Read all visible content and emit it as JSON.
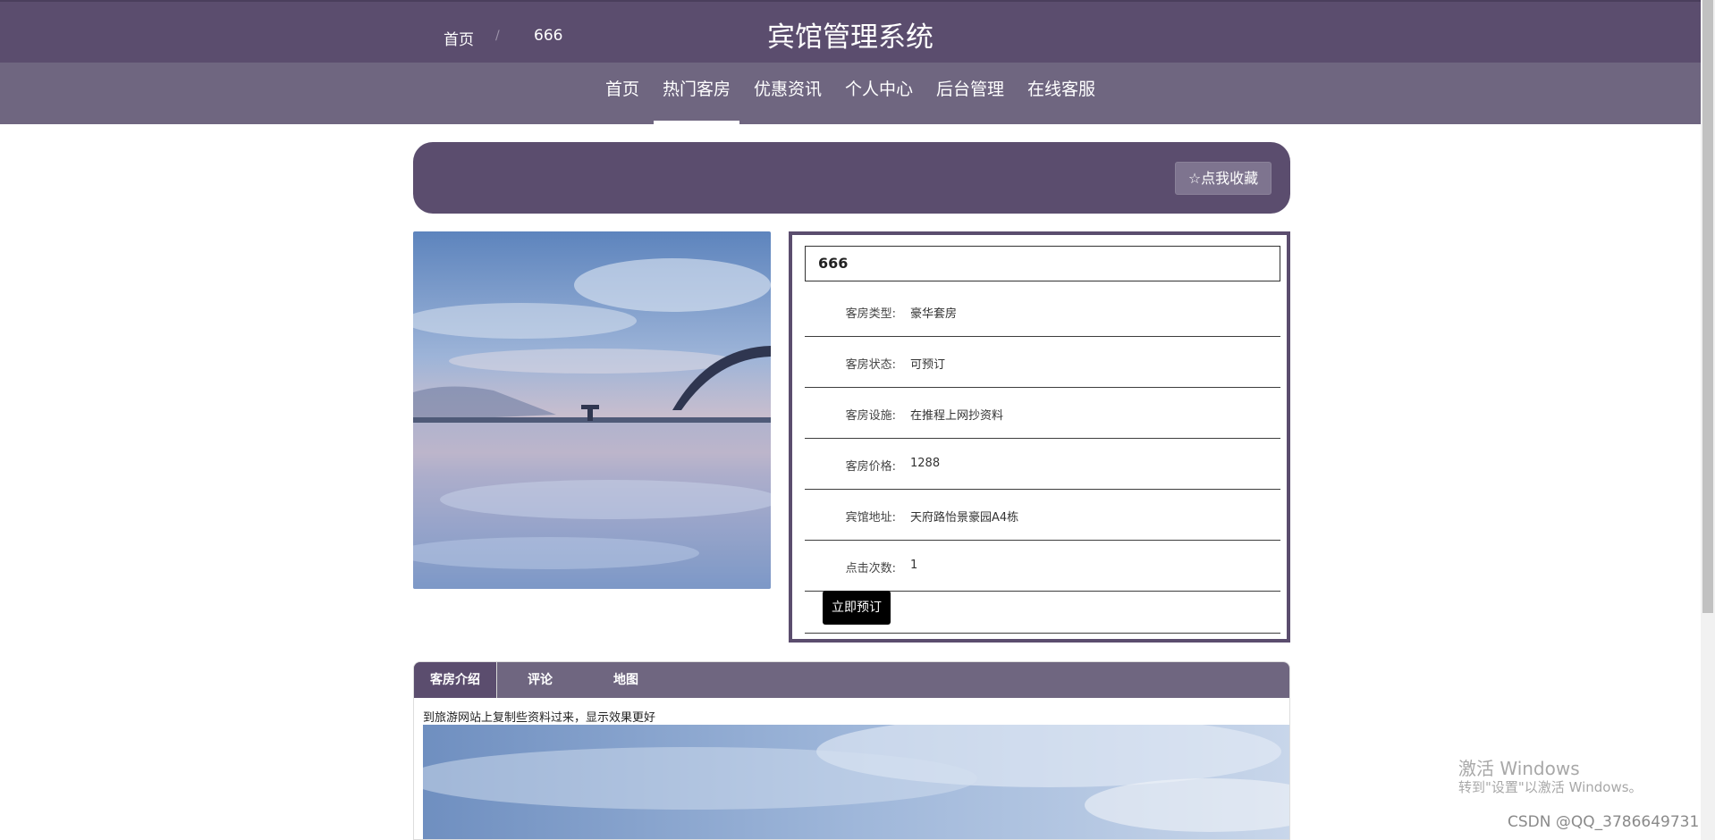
{
  "header": {
    "title": "宾馆管理系统"
  },
  "nav": {
    "items": [
      {
        "label": "首页"
      },
      {
        "label": "热门客房",
        "active": true
      },
      {
        "label": "优惠资讯"
      },
      {
        "label": "个人中心"
      },
      {
        "label": "后台管理"
      },
      {
        "label": "在线客服"
      }
    ]
  },
  "breadcrumb": {
    "home": "首页",
    "separator": "/",
    "current": "666"
  },
  "favorite_button": {
    "icon": "star-outline-icon",
    "label": "点我收藏"
  },
  "room": {
    "name": "666",
    "fields": [
      {
        "label": "客房类型:",
        "value": "豪华套房"
      },
      {
        "label": "客房状态:",
        "value": "可预订"
      },
      {
        "label": "客房设施:",
        "value": "在推程上网抄资料"
      },
      {
        "label": "客房价格:",
        "value": "1288"
      },
      {
        "label": "宾馆地址:",
        "value": "天府路怡景豪园A4栋"
      },
      {
        "label": "点击次数:",
        "value": "1"
      }
    ],
    "book_button": "立即预订"
  },
  "tabs": {
    "items": [
      {
        "label": "客房介绍",
        "active": true
      },
      {
        "label": "评论"
      },
      {
        "label": "地图"
      }
    ],
    "intro_text": "到旅游网站上复制些资料过来，显示效果更好"
  },
  "overlay": {
    "activate_title": "激活 Windows",
    "activate_sub": "转到\"设置\"以激活 Windows。",
    "csdn": "CSDN @QQ_3786649731"
  },
  "colors": {
    "primary": "#5b4d6e",
    "nav": "#6f6680",
    "accent_button": "#000000"
  }
}
